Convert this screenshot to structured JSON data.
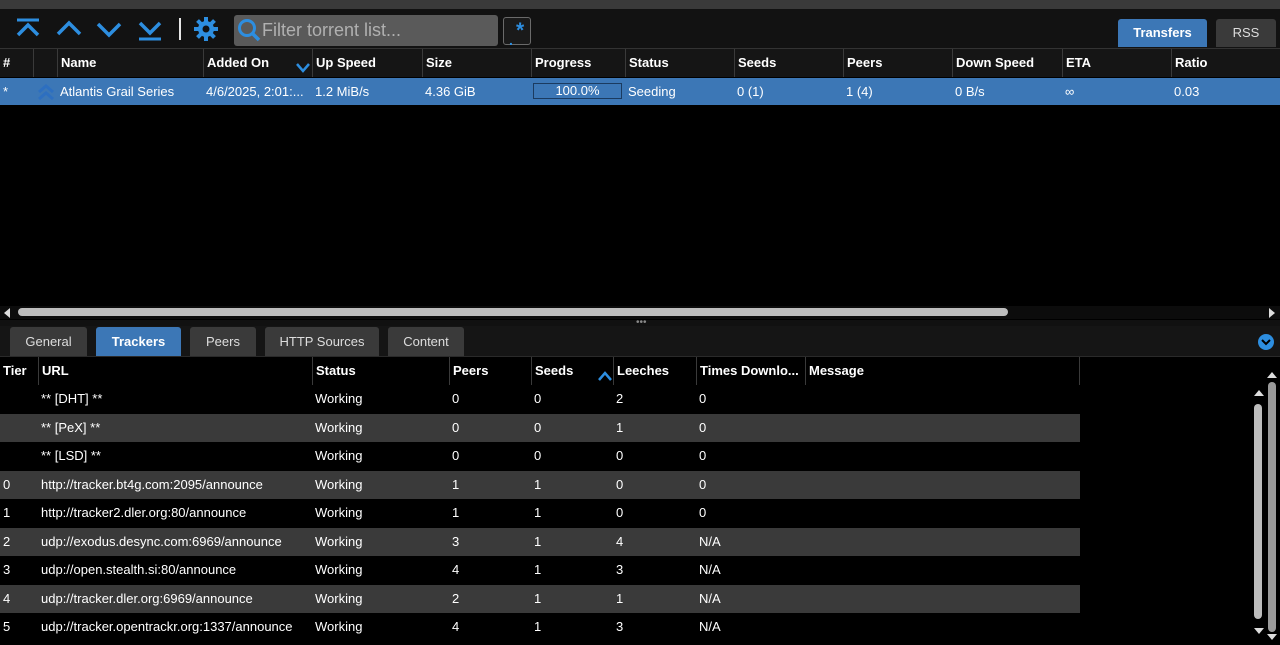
{
  "toolbar": {
    "icons": [
      "move-to-top-icon",
      "move-up-icon",
      "move-down-icon",
      "move-to-bottom-icon",
      "gear-icon",
      "search-icon",
      "regex-icon"
    ],
    "search_placeholder": "Filter torrent list...",
    "tabs": {
      "transfers": "Transfers",
      "rss": "RSS"
    }
  },
  "accent_color": "#3c77b6",
  "transfers": {
    "columns": [
      "#",
      "",
      "Name",
      "Added On",
      "Up Speed",
      "Size",
      "Progress",
      "Status",
      "Seeds",
      "Peers",
      "Down Speed",
      "ETA",
      "Ratio"
    ],
    "sorted_column": "Added On",
    "sort_direction": "descending",
    "rows": [
      {
        "num": "*",
        "state_icon": "seeding-up-icon",
        "name": "Atlantis Grail Series",
        "added_on": "4/6/2025, 2:01:...",
        "up_speed": "1.2 MiB/s",
        "size": "4.36 GiB",
        "progress": "100.0%",
        "progress_fraction": 1.0,
        "status": "Seeding",
        "seeds": "0 (1)",
        "peers": "1 (4)",
        "down_speed": "0 B/s",
        "eta": "∞",
        "ratio": "0.03"
      }
    ]
  },
  "properties": {
    "tabs": [
      "General",
      "Trackers",
      "Peers",
      "HTTP Sources",
      "Content"
    ],
    "active_tab": "Trackers"
  },
  "trackers": {
    "columns": [
      "Tier",
      "URL",
      "Status",
      "Peers",
      "Seeds",
      "Leeches",
      "Times Downlo...",
      "Message"
    ],
    "sorted_column": "Seeds",
    "sort_direction": "ascending",
    "rows": [
      {
        "tier": "",
        "url": "** [DHT] **",
        "status": "Working",
        "peers": "0",
        "seeds": "0",
        "leeches": "2",
        "downloaded": "0",
        "message": ""
      },
      {
        "tier": "",
        "url": "** [PeX] **",
        "status": "Working",
        "peers": "0",
        "seeds": "0",
        "leeches": "1",
        "downloaded": "0",
        "message": ""
      },
      {
        "tier": "",
        "url": "** [LSD] **",
        "status": "Working",
        "peers": "0",
        "seeds": "0",
        "leeches": "0",
        "downloaded": "0",
        "message": ""
      },
      {
        "tier": "0",
        "url": "http://tracker.bt4g.com:2095/announce",
        "status": "Working",
        "peers": "1",
        "seeds": "1",
        "leeches": "0",
        "downloaded": "0",
        "message": ""
      },
      {
        "tier": "1",
        "url": "http://tracker2.dler.org:80/announce",
        "status": "Working",
        "peers": "1",
        "seeds": "1",
        "leeches": "0",
        "downloaded": "0",
        "message": ""
      },
      {
        "tier": "2",
        "url": "udp://exodus.desync.com:6969/announce",
        "status": "Working",
        "peers": "3",
        "seeds": "1",
        "leeches": "4",
        "downloaded": "N/A",
        "message": ""
      },
      {
        "tier": "3",
        "url": "udp://open.stealth.si:80/announce",
        "status": "Working",
        "peers": "4",
        "seeds": "1",
        "leeches": "3",
        "downloaded": "N/A",
        "message": ""
      },
      {
        "tier": "4",
        "url": "udp://tracker.dler.org:6969/announce",
        "status": "Working",
        "peers": "2",
        "seeds": "1",
        "leeches": "1",
        "downloaded": "N/A",
        "message": ""
      },
      {
        "tier": "5",
        "url": "udp://tracker.opentrackr.org:1337/announce",
        "status": "Working",
        "peers": "4",
        "seeds": "1",
        "leeches": "3",
        "downloaded": "N/A",
        "message": ""
      }
    ]
  }
}
